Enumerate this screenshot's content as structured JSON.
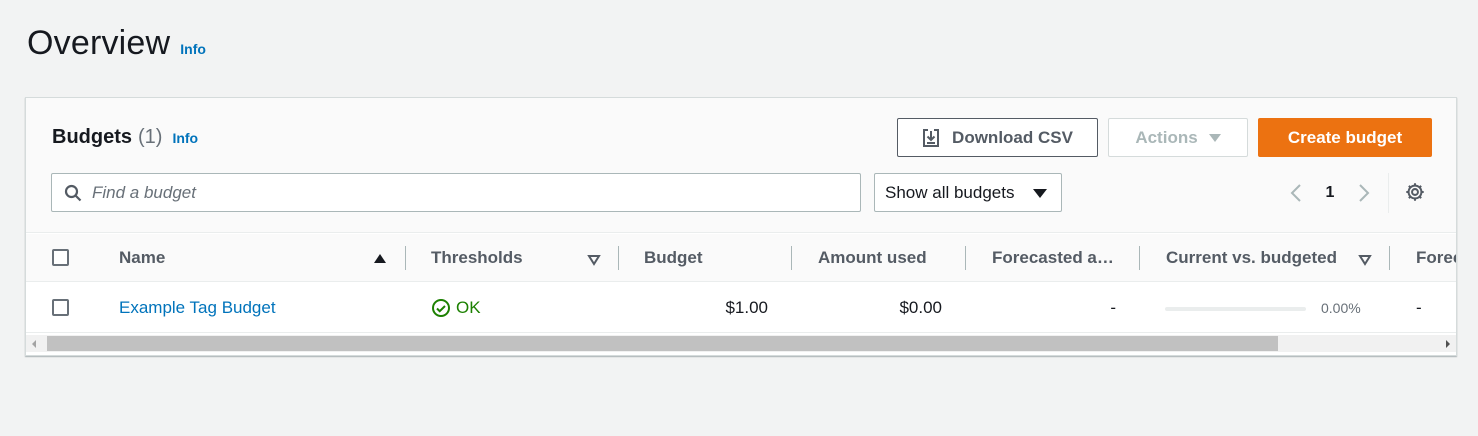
{
  "page": {
    "title": "Overview",
    "info_label": "Info"
  },
  "budgets": {
    "title": "Budgets",
    "count": "(1)",
    "info_label": "Info",
    "download_label": "Download CSV",
    "actions_label": "Actions",
    "create_label": "Create budget",
    "search_placeholder": "Find a budget",
    "filter_selected": "Show all budgets",
    "current_page": "1"
  },
  "table": {
    "columns": {
      "name": "Name",
      "thresholds": "Thresholds",
      "budget": "Budget",
      "amount_used": "Amount used",
      "forecasted": "Forecasted a…",
      "current_vs_budgeted": "Current vs. budgeted",
      "forecasted_2": "Forec"
    },
    "rows": [
      {
        "name": "Example Tag Budget",
        "thresholds": "OK",
        "budget": "$1.00",
        "amount_used": "$0.00",
        "forecasted": "-",
        "current_vs_budgeted": "0.00%",
        "current_vs_budgeted_fraction": 0,
        "forecasted_2": "-"
      }
    ]
  },
  "colors": {
    "primary": "#ec7211",
    "link": "#0073bb",
    "success": "#1d8102",
    "background": "#f2f3f3"
  },
  "icons": {
    "download": "download-icon",
    "search": "search-icon",
    "settings": "gear-icon",
    "ok": "check-circle-icon"
  }
}
